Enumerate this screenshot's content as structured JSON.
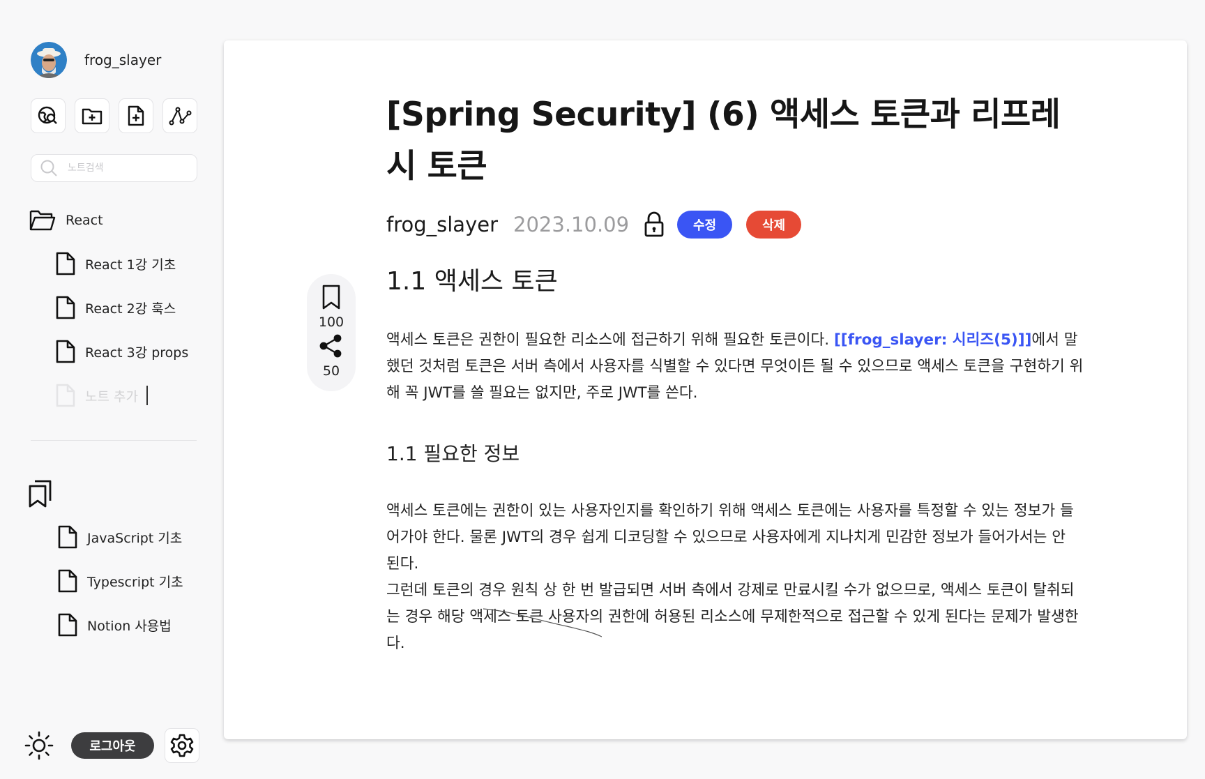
{
  "sidebar": {
    "username": "frog_slayer",
    "search_placeholder": "노트검색",
    "folder": {
      "label": "React"
    },
    "notes": [
      {
        "label": "React 1강 기초"
      },
      {
        "label": "React 2강 훅스"
      },
      {
        "label": "React 3강 props"
      }
    ],
    "add_note_label": "노트 추가",
    "bookmarks": [
      {
        "label": "JavaScript 기초"
      },
      {
        "label": "Typescript 기초"
      },
      {
        "label": "Notion 사용법"
      }
    ],
    "logout_label": "로그아웃",
    "icons": [
      "globe-search-icon",
      "folder-plus-icon",
      "file-plus-icon",
      "graph-icon",
      "sun-icon",
      "gear-icon",
      "bookmarks-icon"
    ]
  },
  "article": {
    "title": "[Spring Security] (6) 액세스 토큰과 리프레시 토큰",
    "author": "frog_slayer",
    "date": "2023.10.09",
    "edit_label": "수정",
    "delete_label": "삭제",
    "heading1": "1.1 액세스 토큰",
    "para1_text": "액세스 토큰은 권한이 필요한 리소스에 접근하기 위해 필요한 토큰이다. ",
    "para1_link": "[[frog_slayer: 시리즈(5)]]",
    "para1_rest": "에서 말했던 것처럼 토큰은 서버 측에서 사용자를 식별할 수 있다면 무엇이든 될 수 있으므로 액세스 토큰을 구현하기 위해 꼭 JWT를 쓸 필요는 없지만, 주로 JWT를 쓴다.",
    "heading2": "1.1 필요한 정보",
    "para2": "액세스 토큰에는 권한이 있는 사용자인지를 확인하기 위해 액세스 토큰에는 사용자를 특정할 수 있는 정보가 들어가야 한다. 물론 JWT의 경우 쉽게 디코딩할 수 있으므로 사용자에게 지나치게 민감한 정보가 들어가서는 안 된다.",
    "para3": "그런데 토큰의 경우 원칙 상 한 번 발급되면 서버 측에서 강제로 만료시킬 수가 없으므로, 액세스 토큰이 탈취되는 경우 해당 액세스 토큰 사용자의 권한에 허용된 리소스에 무제한적으로 접근할 수 있게 된다는 문제가 발생한다."
  },
  "actions": {
    "bookmark_count": "100",
    "share_count": "50"
  },
  "colors": {
    "accent": "#3a55f4",
    "danger": "#e64a35",
    "logout_bg": "#3d3d3f"
  }
}
